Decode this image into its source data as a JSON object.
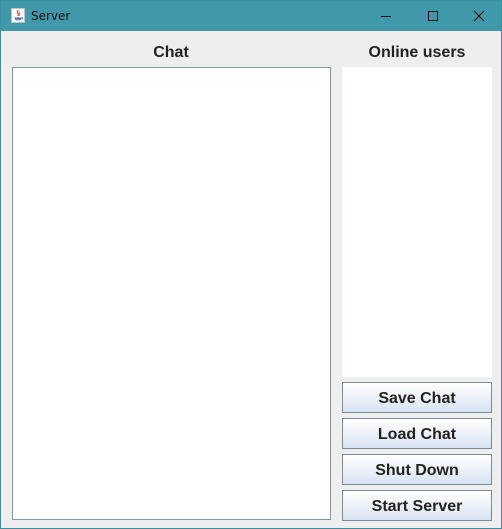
{
  "window": {
    "title": "Server",
    "title_bar_color": "#4198aa",
    "controls": {
      "minimize_icon": "minimize-icon",
      "maximize_icon": "maximize-icon",
      "close_icon": "close-icon"
    }
  },
  "chat": {
    "heading": "Chat"
  },
  "users": {
    "heading": "Online users"
  },
  "buttons": {
    "save_label": "Save Chat",
    "load_label": "Load Chat",
    "shutdown_label": "Shut Down",
    "start_label": "Start Server"
  }
}
